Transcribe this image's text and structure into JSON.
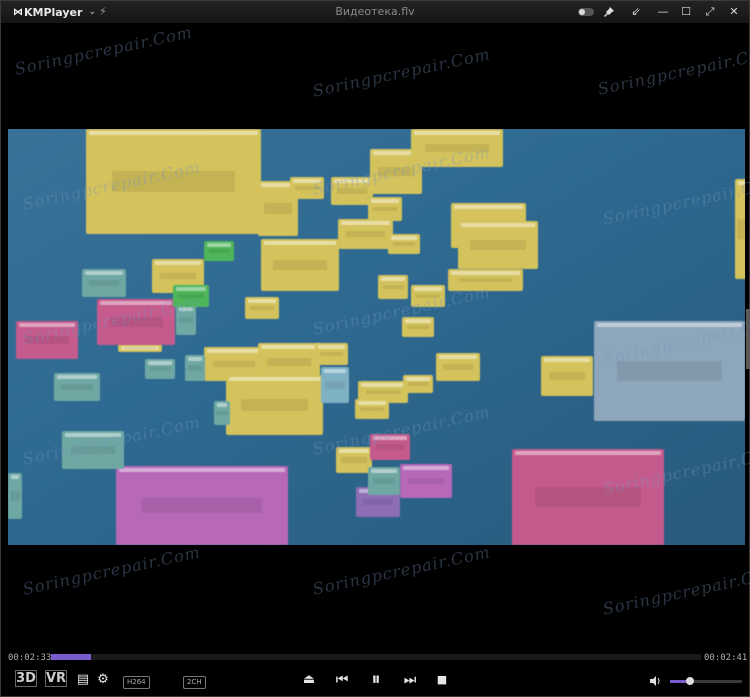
{
  "app": {
    "name": "KMPlayer",
    "logo_glyph": "⋈",
    "menu_caret": "⌄"
  },
  "window": {
    "title": "Видеотека.flv"
  },
  "titlebar_icons": {
    "bolt": "⚡",
    "pin": "📌",
    "minimize_to_mini": "⇙",
    "minimize": "—",
    "maximize": "☐",
    "fullscreen": "⤢",
    "close": "✕"
  },
  "watermark": "Soringpcrepair.Com",
  "playback": {
    "elapsed": "00:02:33",
    "total": "00:02:41",
    "progress_fraction": 0.062,
    "volume_fraction": 0.28
  },
  "controls": {
    "btn_3d": "3D",
    "btn_vr": "VR",
    "playlist_icon": "▤",
    "settings_icon": "⚙",
    "codec_badge": "H264",
    "audio_badge": "2CH",
    "eject_icon": "⏏",
    "prev_icon": "⏮",
    "pause_icon": "⏸",
    "next_icon": "⏭",
    "stop_icon": "■",
    "volume_icon": "🔊"
  },
  "colors": {
    "accent": "#7a5ccd",
    "video_bg": "#2f6a92",
    "chrome": "#151515"
  }
}
